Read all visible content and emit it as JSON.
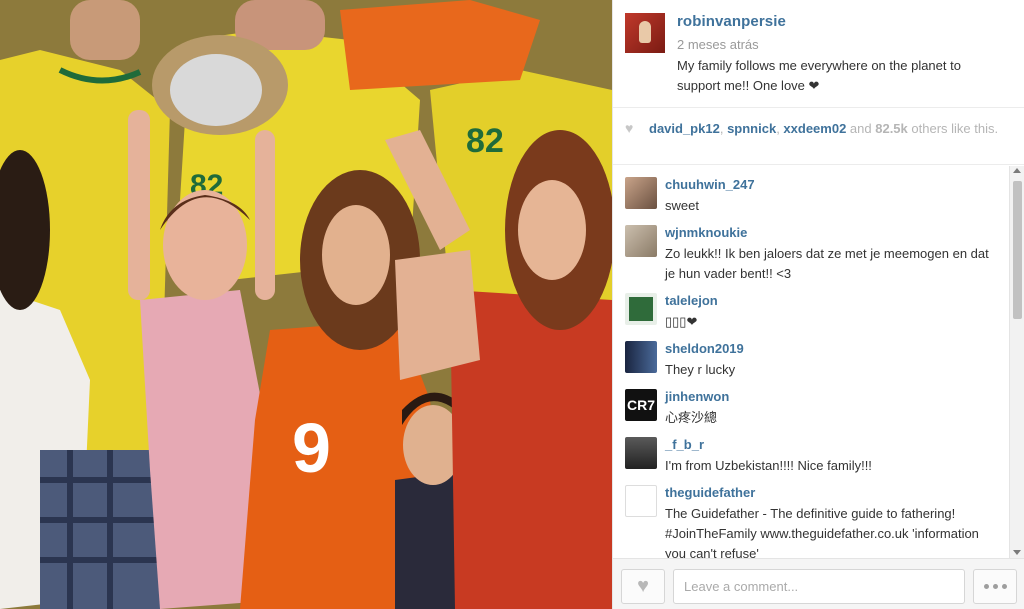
{
  "post": {
    "owner": "robinvanpersie",
    "time": "2 meses atrás",
    "caption": "My family follows me everywhere on the planet to support me!! One love ❤"
  },
  "likes": {
    "users": [
      "david_pk12",
      "spnnick",
      "xxdeem02"
    ],
    "sep1": ", ",
    "sep2": ", ",
    "and_text": " and ",
    "count": "82.5k",
    "suffix": " others like this."
  },
  "comments": [
    {
      "user": "chuuhwin_247",
      "text": "sweet",
      "avatar_color": "#7a6a5a"
    },
    {
      "user": "wjnmknoukie",
      "text": "Zo leukk!! Ik ben jaloers dat ze met je meemogen en dat je hun vader bent!! <3",
      "avatar_color": "#9a8f84"
    },
    {
      "user": "talelejon",
      "text": "\u0000\u0000\u0000❤",
      "avatar_color": "#2f6b3a"
    },
    {
      "user": "sheldon2019",
      "text": "They r lucky",
      "avatar_color": "#2a3a5a"
    },
    {
      "user": "jinhenwon",
      "text": "心疼沙總",
      "avatar_color": "#111111"
    },
    {
      "user": "_f_b_r",
      "text": "I'm from Uzbekistan!!!! Nice family!!!",
      "avatar_color": "#3a3a3a"
    },
    {
      "user": "theguidefather",
      "text": "The Guidefather - The definitive guide to fathering! #JoinTheFamily www.theguidefather.co.uk 'information you can't refuse'",
      "avatar_color": "#ffffff"
    }
  ],
  "talelejon_display": "▯▯▯❤",
  "comment_input": {
    "placeholder": "Leave a comment..."
  },
  "avatar_label_cr7": "CR7",
  "colors": {
    "username": "#3f729b",
    "meta": "#999999",
    "accent_orange": "#e35f16"
  }
}
